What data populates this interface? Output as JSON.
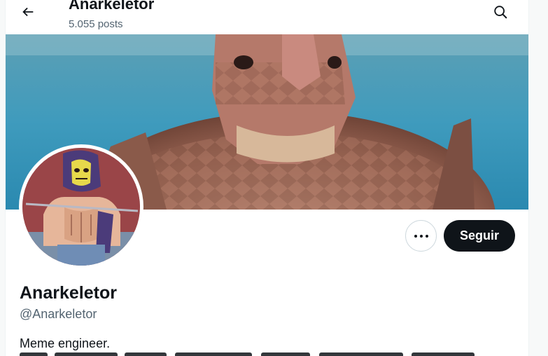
{
  "header": {
    "title": "Anarkeletor",
    "post_count": "5.055 posts",
    "back_icon": "arrow-left-icon",
    "search_icon": "search-icon"
  },
  "profile": {
    "display_name": "Anarkeletor",
    "handle": "@Anarkeletor",
    "bio_line_1": "Meme engineer."
  },
  "actions": {
    "more_icon": "more-horizontal-icon",
    "follow_label": "Seguir"
  },
  "colors": {
    "text_primary": "#0f1419",
    "text_secondary": "#536471",
    "button_dark": "#0f1419",
    "border": "#cfd9de"
  }
}
